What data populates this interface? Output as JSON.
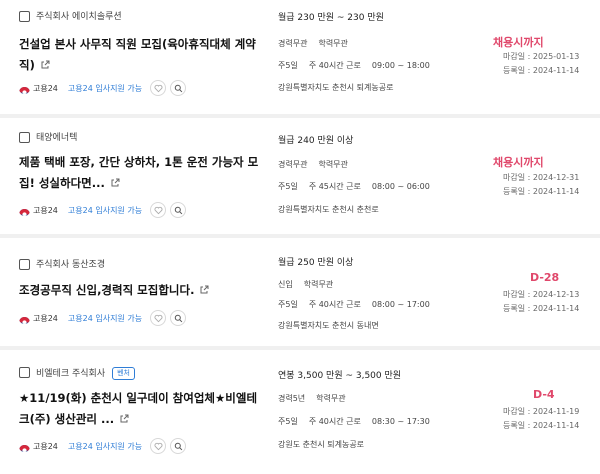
{
  "listings": [
    {
      "company": "주식회사 에이치솔루션",
      "tag": "",
      "title_line1": "건설업 본사 사무직 직원 모집(육아휴직대체 계약",
      "title_line2": "직)",
      "brand_name": "고용24",
      "support_label": "고용24 입사지원 가능",
      "salary": "월급 230 만원 ~ 230 만원",
      "experience": "경력무관",
      "education": "학력무관",
      "workdays": "주5일",
      "weekly_hours": "주 40시간 근로",
      "work_time": "09:00 ~ 18:00",
      "location": "강원특별자치도 춘천시 퇴계농공로",
      "deadline_label": "채용시까지",
      "closing_date": "마감일 : 2025-01-13",
      "posted_date": "등록일 : 2024-11-14"
    },
    {
      "company": "태양에너텍",
      "tag": "",
      "title_line1": "제품 택배 포장, 간단 상하차, 1톤 운전 가능자 모",
      "title_line2": "집! 성실하다면...",
      "brand_name": "고용24",
      "support_label": "고용24 입사지원 가능",
      "salary": "월급 240 만원 이상",
      "experience": "경력무관",
      "education": "학력무관",
      "workdays": "주5일",
      "weekly_hours": "주 45시간 근로",
      "work_time": "08:00 ~ 06:00",
      "location": "강원특별자치도 춘천시 춘천로",
      "deadline_label": "채용시까지",
      "closing_date": "마감일 : 2024-12-31",
      "posted_date": "등록일 : 2024-11-14"
    },
    {
      "company": "주식회사 동산조경",
      "tag": "",
      "title_line1": "조경공무직 신입,경력직 모집합니다.",
      "title_line2": "",
      "brand_name": "고용24",
      "support_label": "고용24 입사지원 가능",
      "salary": "월급 250 만원 이상",
      "experience": "신입",
      "education": "학력무관",
      "workdays": "주5일",
      "weekly_hours": "주 40시간 근로",
      "work_time": "08:00 ~ 17:00",
      "location": "강원특별자치도 춘천시 동내면",
      "deadline_label": "D-28",
      "closing_date": "마감일 : 2024-12-13",
      "posted_date": "등록일 : 2024-11-14"
    },
    {
      "company": "비엘테크 주식회사",
      "tag": "벤처",
      "title_line1": "★11/19(화) 춘천시 일구데이 참여업체★비엘테",
      "title_line2": "크(주) 생산관리 ...",
      "brand_name": "고용24",
      "support_label": "고용24 입사지원 가능",
      "salary": "연봉 3,500 만원 ~ 3,500 만원",
      "experience": "경력5년",
      "education": "학력무관",
      "workdays": "주5일",
      "weekly_hours": "주 40시간 근로",
      "work_time": "08:30 ~ 17:30",
      "location": "강원도 춘천시 퇴계농공로",
      "deadline_label": "D-4",
      "closing_date": "마감일 : 2024-11-19",
      "posted_date": "등록일 : 2024-11-14"
    }
  ],
  "icons": {
    "external_link": "external-link-icon",
    "heart": "heart-icon",
    "search": "search-icon",
    "brand_logo": "goyong24-logo"
  },
  "colors": {
    "accent_blue": "#2f7dd6",
    "deadline_pink": "#e0486b",
    "separator": "#f0f0f0"
  }
}
